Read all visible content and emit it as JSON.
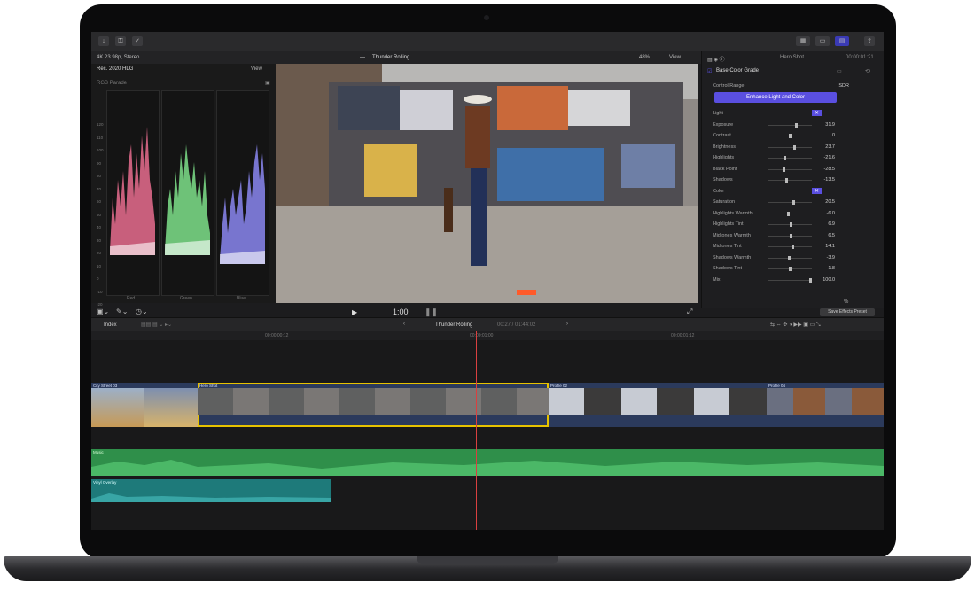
{
  "toolbar": {
    "title": "Thunder Rolling",
    "zoom": "48%",
    "view": "View",
    "format": "4K 23.98p, Stereo"
  },
  "scopes": {
    "standard": "Rec. 2020 HLG",
    "view": "View",
    "mode": "RGB Parade",
    "scale": [
      "120",
      "110",
      "100",
      "90",
      "80",
      "70",
      "60",
      "50",
      "40",
      "30",
      "20",
      "10",
      "0",
      "-10",
      "-20"
    ],
    "channels": [
      "Red",
      "Green",
      "Blue"
    ]
  },
  "viewer": {
    "timecode": "1:00"
  },
  "inspector": {
    "clip_name": "Hero Shot",
    "duration": "00:00:01:21",
    "effect": "Base Color Grade",
    "control_range_label": "Control Range",
    "control_range_value": "SDR",
    "enhance_button": "Enhance Light and Color",
    "params": [
      {
        "label": "Light",
        "value": ""
      },
      {
        "label": "Exposure",
        "value": "31.9"
      },
      {
        "label": "Contrast",
        "value": "0"
      },
      {
        "label": "Brightness",
        "value": "23.7"
      },
      {
        "label": "Highlights",
        "value": "-21.6"
      },
      {
        "label": "Black Point",
        "value": "-28.5"
      },
      {
        "label": "Shadows",
        "value": "-13.5"
      },
      {
        "label": "Color",
        "value": ""
      },
      {
        "label": "Saturation",
        "value": "20.5"
      },
      {
        "label": "Highlights Warmth",
        "value": "-6.0"
      },
      {
        "label": "Highlights Tint",
        "value": "6.9"
      },
      {
        "label": "Midtones Warmth",
        "value": "6.5"
      },
      {
        "label": "Midtones Tint",
        "value": "14.1"
      },
      {
        "label": "Shadows Warmth",
        "value": "-3.9"
      },
      {
        "label": "Shadows Tint",
        "value": "1.8"
      },
      {
        "label": "Mix",
        "value": "100.0"
      }
    ],
    "mix_unit": "%",
    "save_preset": "Save Effects Preset"
  },
  "timeline": {
    "index_label": "Index",
    "project": "Thunder Rolling",
    "position": "00:27 / 01:44:02",
    "ruler_marks": [
      "00:00:00:12",
      "00:00:01:00",
      "00:00:01:12"
    ],
    "clips": [
      {
        "name": "City Street 03"
      },
      {
        "name": "Hero Shot"
      },
      {
        "name": "Profile 02"
      },
      {
        "name": "Profile 04"
      }
    ],
    "audio": [
      {
        "name": "Music"
      },
      {
        "name": "Vinyl Overlay"
      }
    ]
  },
  "colors": {
    "accent": "#5a4fe0",
    "selection": "#e6c200",
    "music_lane": "#2f8f4a",
    "vinyl_lane": "#1e7a7a",
    "playhead": "#d94040"
  }
}
